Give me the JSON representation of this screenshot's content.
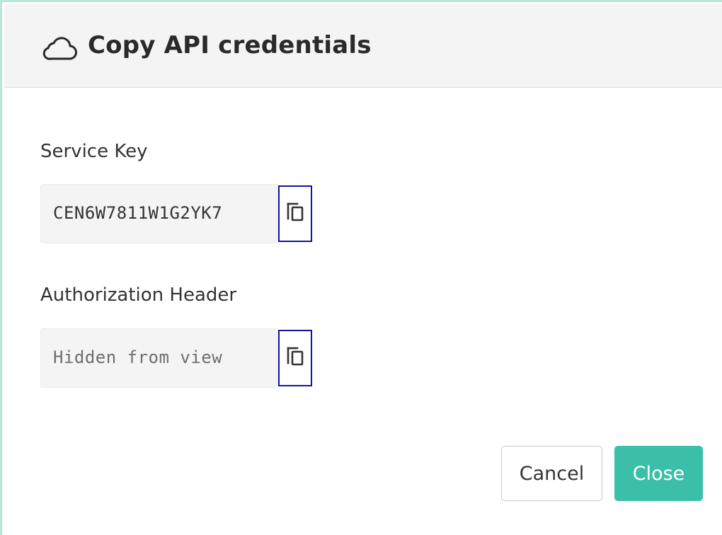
{
  "dialog": {
    "title": "Copy API credentials",
    "title_icon": "cloud-icon"
  },
  "fields": {
    "service_key": {
      "label": "Service Key",
      "value": "CEN6W7811W1G2YK7",
      "copy_icon": "copy-icon"
    },
    "authorization_header": {
      "label": "Authorization Header",
      "value": "Hidden from view",
      "copy_icon": "copy-icon"
    }
  },
  "actions": {
    "cancel_label": "Cancel",
    "close_label": "Close"
  },
  "colors": {
    "accent": "#3cbfa8",
    "header_background": "#f4f4f4",
    "focus_outline": "#1414a0",
    "modal_border": "#b9e6dd"
  }
}
